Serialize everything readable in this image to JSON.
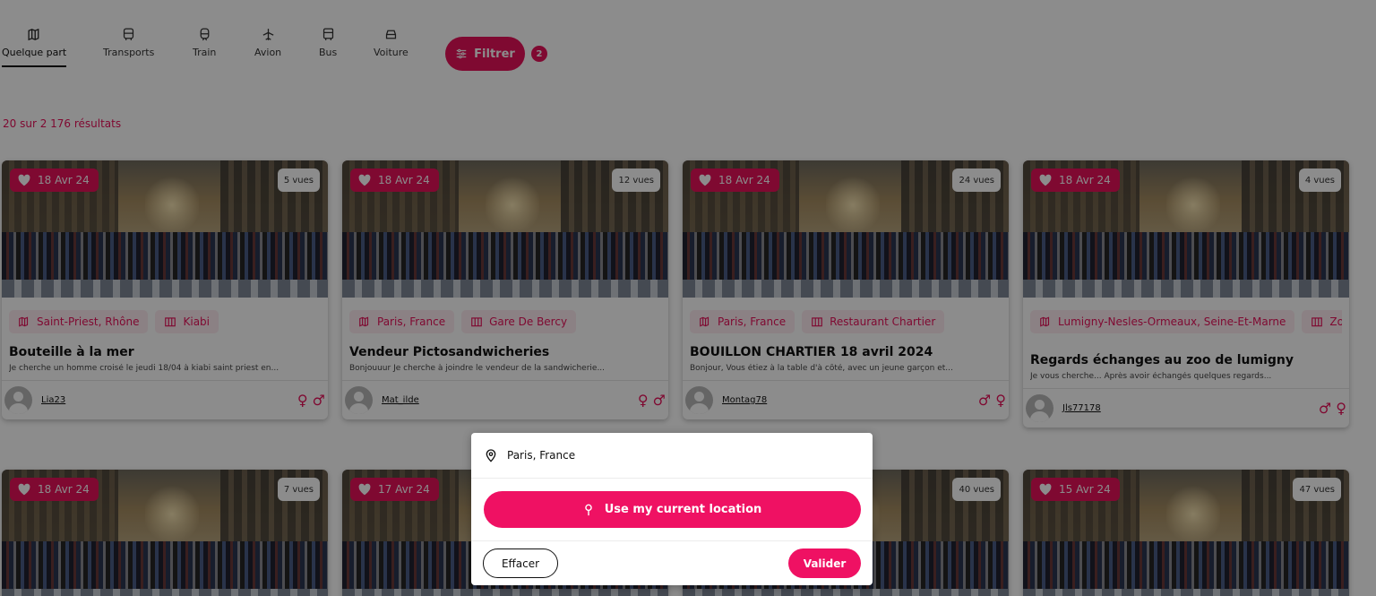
{
  "tabs": [
    {
      "label": "Quelque part",
      "icon": "map-icon",
      "active": true
    },
    {
      "label": "Transports",
      "icon": "bus-icon"
    },
    {
      "label": "Train",
      "icon": "train-icon"
    },
    {
      "label": "Avion",
      "icon": "plane-icon"
    },
    {
      "label": "Bus",
      "icon": "bus-icon"
    },
    {
      "label": "Voiture",
      "icon": "car-icon"
    }
  ],
  "filter": {
    "label": "Filtrer",
    "count": "2"
  },
  "results_text": "20 sur 2 176 résultats",
  "accent_color": "#e8115a",
  "cards": [
    {
      "date": "18 Avr 24",
      "views": "5 vues",
      "location": "Saint-Priest, Rhône",
      "place": "Kiabi",
      "title": "Bouteille à la mer",
      "description": "Je cherche un homme croisé le jeudi 18/04 à kiabi saint priest en...",
      "user": "Lia23",
      "genders": "♀ ♂"
    },
    {
      "date": "18 Avr 24",
      "views": "12 vues",
      "location": "Paris, France",
      "place": "Gare De Bercy",
      "title": "Vendeur Pictosandwicheries",
      "description": "Bonjouuur Je cherche à joindre le vendeur de la sandwicherie...",
      "user": "Mat_ilde",
      "genders": "♀ ♂"
    },
    {
      "date": "18 Avr 24",
      "views": "24 vues",
      "location": "Paris, France",
      "place": "Restaurant Chartier",
      "title": "BOUILLON CHARTIER 18 avril 2024",
      "description": "Bonjour, Vous étiez à la table d'à côté, avec un jeune garçon et...",
      "user": "Montag78",
      "genders": "♂ ♀"
    },
    {
      "date": "18 Avr 24",
      "views": "4 vues",
      "location": "Lumigny-Nesles-Ormeaux, Seine-Et-Marne",
      "place": "Zo",
      "title": "Regards échanges au zoo de lumigny",
      "description": "Je vous cherche... Après avoir échangés quelques regards...",
      "user": "Jls77178",
      "genders": "♂ ♀"
    },
    {
      "date": "18 Avr 24",
      "views": "7 vues"
    },
    {
      "date": "17 Avr 24",
      "views": ""
    },
    {
      "date": "",
      "views": "40 vues"
    },
    {
      "date": "15 Avr 24",
      "views": "47 vues"
    }
  ],
  "location_popup": {
    "value": "Paris, France",
    "use_current_label": "Use my current location",
    "clear_label": "Effacer",
    "validate_label": "Valider"
  }
}
